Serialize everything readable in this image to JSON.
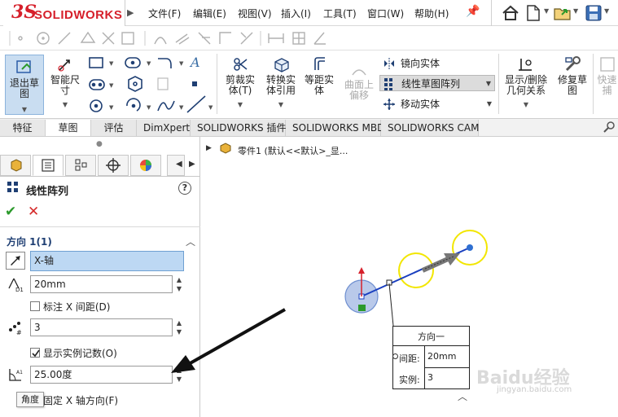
{
  "app": {
    "logo_prefix": "3S",
    "logo_text": "SOLIDWORKS"
  },
  "menu": [
    {
      "label": "文件(F)"
    },
    {
      "label": "编辑(E)"
    },
    {
      "label": "视图(V)"
    },
    {
      "label": "插入(I)"
    },
    {
      "label": "工具(T)"
    },
    {
      "label": "窗口(W)"
    },
    {
      "label": "帮助(H)"
    }
  ],
  "quick_access_icons": [
    "home-icon",
    "new-document-icon",
    "open-folder-icon",
    "save-icon"
  ],
  "ribbon": {
    "exit_sketch": "退出草\n图",
    "smart_dimension": "智能尺\n寸",
    "trim_entities": "剪裁实\n体(T)",
    "convert_entities": "转换实\n体引用",
    "offset_entities": "等距实\n体",
    "offset_surface": "曲面上\n偏移",
    "mirror_entities": "镜向实体",
    "linear_sketch_pattern": "线性草图阵列",
    "move_entities": "移动实体",
    "show_delete_relations": "显示/删除\n几何关系",
    "repair_sketch": "修复草\n图",
    "rapid_sketch": "快速\n捕"
  },
  "tabs": [
    {
      "label": "特征",
      "active": false
    },
    {
      "label": "草图",
      "active": true
    },
    {
      "label": "评估",
      "active": false
    },
    {
      "label": "DimXpert",
      "active": false
    },
    {
      "label": "SOLIDWORKS 插件",
      "active": false
    },
    {
      "label": "SOLIDWORKS MBD",
      "active": false
    },
    {
      "label": "SOLIDWORKS CAM",
      "active": false
    }
  ],
  "property_manager": {
    "title": "线性阵列",
    "help": "?",
    "ok": "✔",
    "cancel": "✕",
    "direction_title": "方向 1(1)",
    "direction_axis": "X-轴",
    "spacing": "20mm",
    "dimension_x_spacing": "标注 X 间距(D)",
    "dimension_x_spacing_checked": false,
    "instances": "3",
    "display_instance_count": "显示实例记数(O)",
    "display_instance_count_checked": true,
    "angle": "25.00度",
    "fix_x_axis": "固定 X 轴方向(F)",
    "tooltip": "角度"
  },
  "feature_tree": {
    "root": "零件1  (默认<<默认>_显..."
  },
  "callout": {
    "title": "方向一",
    "spacing_label": "间距:",
    "spacing_value": "20mm",
    "instances_label": "实例:",
    "instances_value": "3"
  },
  "watermark": {
    "text": "Baidu经验",
    "sub": "jingyan.baidu.com"
  },
  "colors": {
    "accent_blue": "#1f3f73",
    "selection": "#bdd8f3",
    "logo_red": "#d6202b",
    "ok_green": "#2c9a2c",
    "cancel_red": "#d52b2b",
    "pattern_yellow": "#f2e600",
    "sketch_blue": "#1a3fbf"
  }
}
